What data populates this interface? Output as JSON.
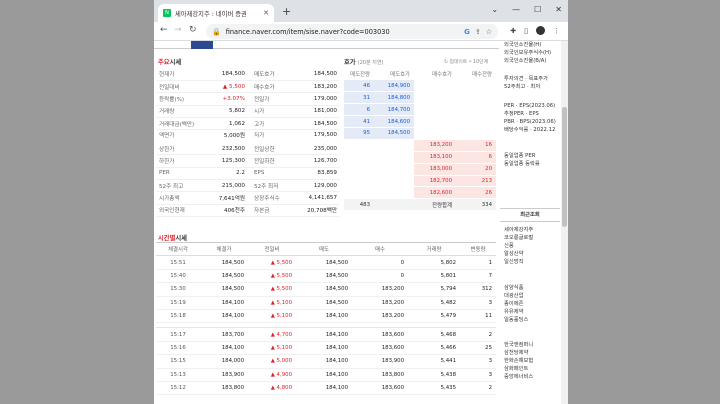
{
  "tab_title": "세아제강지주 : 네이버 증권",
  "url": "finance.naver.com/item/sise.naver?code=003030",
  "main_section": {
    "title_red": "주요",
    "title_rest": "시세"
  },
  "quote_rows": [
    {
      "a": "현재가",
      "b": "184,500",
      "c": "매도호가",
      "d": "184,500",
      "bcls": ""
    },
    {
      "a": "전일대비",
      "b": "▲ 5,500",
      "c": "매수호가",
      "d": "183,200",
      "bcls": "up"
    },
    {
      "a": "등락률(%)",
      "b": "+3.07%",
      "c": "전일가",
      "d": "179,000",
      "bcls": "up"
    },
    {
      "a": "거래량",
      "b": "5,802",
      "c": "시가",
      "d": "181,000",
      "bcls": ""
    },
    {
      "a": "거래대금(백만)",
      "b": "1,062",
      "c": "고가",
      "d": "184,500",
      "bcls": ""
    },
    {
      "a": "액면가",
      "b": "5,000원",
      "c": "저가",
      "d": "179,500",
      "bcls": ""
    },
    {
      "a": "상한가",
      "b": "232,500",
      "c": "전일상한",
      "d": "235,000",
      "bcls": ""
    },
    {
      "a": "하한가",
      "b": "125,300",
      "c": "전일하한",
      "d": "126,700",
      "bcls": ""
    },
    {
      "a": "PER",
      "b": "2.2",
      "c": "EPS",
      "d": "83,859",
      "bcls": ""
    },
    {
      "a": "52주 최고",
      "b": "215,000",
      "c": "52주 최저",
      "d": "129,000",
      "bcls": ""
    },
    {
      "a": "시가총액",
      "b": "7,641억원",
      "c": "상장주식수",
      "d": "4,141,657",
      "bcls": ""
    },
    {
      "a": "외국인현재",
      "b": "406천주",
      "c": "자본금",
      "d": "20,708백만",
      "bcls": ""
    }
  ],
  "orderbook": {
    "title": "호가",
    "subtitle": "(20분 지연)",
    "refresh": "↻ 업데이트 • 10단계",
    "headers": [
      "매도잔량",
      "매도호가",
      "매수호가",
      "매수잔량"
    ],
    "asks": [
      {
        "qty": "46",
        "price": "184,900"
      },
      {
        "qty": "31",
        "price": "184,800"
      },
      {
        "qty": "6",
        "price": "184,700"
      },
      {
        "qty": "41",
        "price": "184,600"
      },
      {
        "qty": "95",
        "price": "184,500"
      }
    ],
    "bids": [
      {
        "price": "183,200",
        "qty": "16"
      },
      {
        "price": "183,100",
        "qty": "6"
      },
      {
        "price": "183,000",
        "qty": "20"
      },
      {
        "price": "182,700",
        "qty": "213"
      },
      {
        "price": "182,600",
        "qty": "26"
      }
    ],
    "total_ask": "483",
    "total_label": "잔량합계",
    "total_bid": "334"
  },
  "time_section": {
    "title_red": "시간별",
    "title_rest": "시세"
  },
  "time_headers": [
    "체결시각",
    "체결가",
    "전일비",
    "매도",
    "매수",
    "거래량",
    "변동량"
  ],
  "time_rows_a": [
    {
      "t": "15:51",
      "p": "184,500",
      "c": "▲ 5,500",
      "s": "184,500",
      "b": "0",
      "v": "5,802",
      "d": "1"
    },
    {
      "t": "15:40",
      "p": "184,500",
      "c": "▲ 5,500",
      "s": "184,500",
      "b": "0",
      "v": "5,801",
      "d": "7"
    },
    {
      "t": "15:30",
      "p": "184,500",
      "c": "▲ 5,500",
      "s": "184,500",
      "b": "183,200",
      "v": "5,794",
      "d": "312"
    },
    {
      "t": "15:19",
      "p": "184,100",
      "c": "▲ 5,100",
      "s": "184,500",
      "b": "183,200",
      "v": "5,482",
      "d": "3"
    },
    {
      "t": "15:18",
      "p": "184,100",
      "c": "▲ 5,100",
      "s": "184,100",
      "b": "183,200",
      "v": "5,479",
      "d": "11"
    }
  ],
  "time_rows_b": [
    {
      "t": "15:17",
      "p": "183,700",
      "c": "▲ 4,700",
      "s": "184,100",
      "b": "183,600",
      "v": "5,468",
      "d": "2"
    },
    {
      "t": "15:16",
      "p": "184,100",
      "c": "▲ 5,100",
      "s": "184,100",
      "b": "183,600",
      "v": "5,466",
      "d": "25"
    },
    {
      "t": "15:15",
      "p": "184,000",
      "c": "▲ 5,000",
      "s": "184,100",
      "b": "183,900",
      "v": "5,441",
      "d": "3"
    },
    {
      "t": "15:13",
      "p": "183,900",
      "c": "▲ 4,900",
      "s": "184,100",
      "b": "183,800",
      "v": "5,438",
      "d": "3"
    },
    {
      "t": "15:12",
      "p": "183,800",
      "c": "▲ 4,800",
      "s": "184,100",
      "b": "183,600",
      "v": "5,435",
      "d": "2"
    }
  ],
  "right_panel": {
    "top": [
      "외국인소진율(H)",
      "외국인보유주식수(H)",
      "외국인소진율(B/A)"
    ],
    "invest": [
      "투자의견 · 목표주가",
      "52주최고 · 최저"
    ],
    "per": [
      "PER · EPS(2023.06)",
      "추정PER · EPS",
      "PBR · BPS(2023.06)",
      "배당수익률 · 2022.12"
    ],
    "sector": [
      "동일업종 PER",
      "동일업종 등락률"
    ],
    "recent_title": "최근조회",
    "recent": [
      "세아제강지주",
      "코오롱글로벌",
      "신풍",
      "알성산약",
      "일신방직"
    ],
    "recent2": [
      "삼양식품",
      "대광산업",
      "종이에존",
      "유유제약",
      "일동홀딩스"
    ],
    "recent3": [
      "한국앤컴퍼니",
      "삼천당제약",
      "한화손해보험",
      "삼화페인트",
      "중앙에너비스"
    ]
  },
  "colors": {
    "up": "#d9232e",
    "down": "#1a5ad8",
    "brand": "#03c75a"
  }
}
